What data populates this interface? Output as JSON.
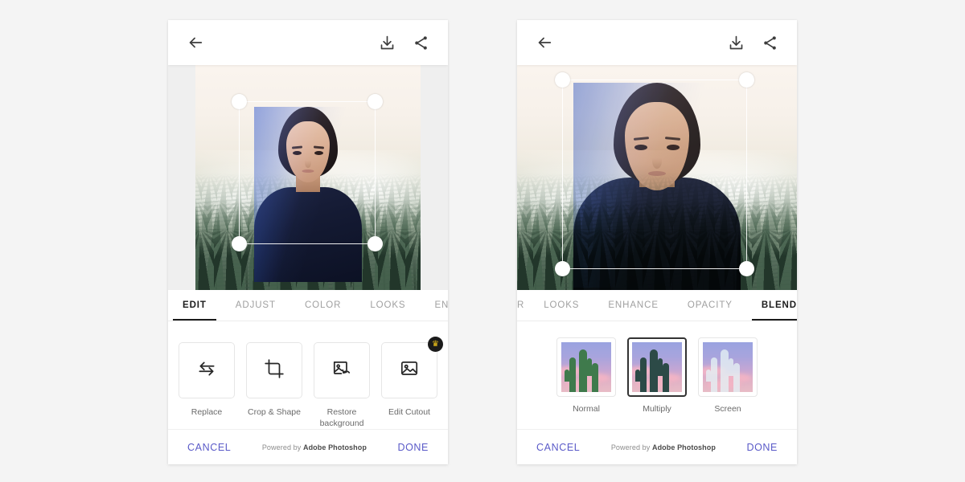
{
  "app": {
    "background_color": "#f4f4f4",
    "accent_color": "#5a5ac8",
    "panel_background": "#ffffff"
  },
  "panels": [
    {
      "id": "left",
      "topbar": {
        "back_label": "←",
        "download_icon": "download-icon",
        "share_icon": "share-icon"
      },
      "canvas": {
        "description": "Portrait of a woman composited over a misty pine forest",
        "transform_frame_visible": true,
        "handles": [
          "top-left",
          "top-right",
          "bottom-left",
          "bottom-right"
        ],
        "blend_applied": "Normal"
      },
      "tabs": [
        {
          "label": "EDIT",
          "active": true
        },
        {
          "label": "ADJUST",
          "active": false
        },
        {
          "label": "COLOR",
          "active": false
        },
        {
          "label": "LOOKS",
          "active": false
        },
        {
          "label": "ENHANCE",
          "active": false
        }
      ],
      "tools": [
        {
          "label": "Replace",
          "icon": "swap-arrows-icon",
          "premium": false
        },
        {
          "label": "Crop & Shape",
          "icon": "crop-icon",
          "premium": false
        },
        {
          "label": "Restore background",
          "icon": "restore-image-icon",
          "premium": false
        },
        {
          "label": "Edit Cutout",
          "icon": "image-cutout-icon",
          "premium": true,
          "badge": "crown-icon"
        }
      ],
      "bottombar": {
        "cancel_label": "CANCEL",
        "powered_prefix": "Powered by ",
        "powered_brand": "Adobe Photoshop",
        "done_label": "DONE"
      }
    },
    {
      "id": "right",
      "topbar": {
        "back_label": "←",
        "download_icon": "download-icon",
        "share_icon": "share-icon"
      },
      "canvas": {
        "description": "Same portrait blended into the forest with Multiply blend mode",
        "transform_frame_visible": true,
        "handles": [
          "top-left",
          "top-right",
          "bottom-left",
          "bottom-right"
        ],
        "blend_applied": "Multiply"
      },
      "tabs": [
        {
          "label": "R",
          "active": false
        },
        {
          "label": "LOOKS",
          "active": false
        },
        {
          "label": "ENHANCE",
          "active": false
        },
        {
          "label": "OPACITY",
          "active": false
        },
        {
          "label": "BLEND",
          "active": true
        }
      ],
      "blend_modes": [
        {
          "label": "Normal",
          "selected": false,
          "thumb": "cactus-sunset-normal"
        },
        {
          "label": "Multiply",
          "selected": true,
          "thumb": "cactus-sunset-multiply"
        },
        {
          "label": "Screen",
          "selected": false,
          "thumb": "cactus-sunset-screen"
        }
      ],
      "bottombar": {
        "cancel_label": "CANCEL",
        "powered_prefix": "Powered by ",
        "powered_brand": "Adobe Photoshop",
        "done_label": "DONE"
      }
    }
  ]
}
